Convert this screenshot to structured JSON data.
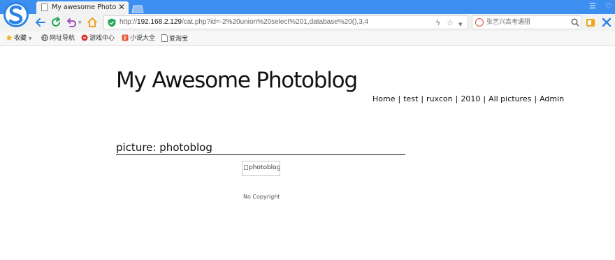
{
  "browser": {
    "tab_title": "My awesome Photoblog",
    "url_scheme": "http://",
    "url_host": "192.168.2.129",
    "url_path": "/cat.php?id=-2%20union%20select%201,database%20(),3,4",
    "search_placeholder": "张艺兴高考遇阻",
    "bookmarks": [
      {
        "label": "收藏",
        "icon": "star-icon"
      },
      {
        "label": "网址导航",
        "icon": "globe-icon"
      },
      {
        "label": "游戏中心",
        "icon": "game-icon"
      },
      {
        "label": "小说大全",
        "icon": "book-icon"
      },
      {
        "label": "爱淘宝",
        "icon": "page-icon"
      }
    ],
    "accent_color": "#3c8ff0"
  },
  "site": {
    "title": "My Awesome Photoblog",
    "nav": [
      "Home",
      "test",
      "ruxcon",
      "2010",
      "All pictures",
      "Admin"
    ],
    "section_title": "picture: photoblog",
    "image_alt": "photoblog",
    "footer": "No Copyright"
  }
}
